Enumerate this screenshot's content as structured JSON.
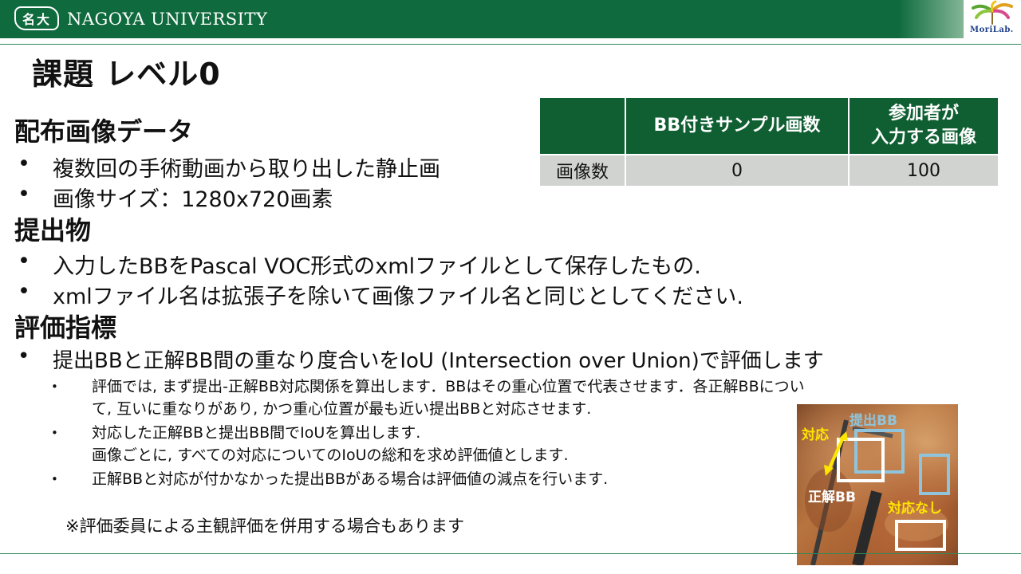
{
  "header": {
    "emblem_text": "名大",
    "university_name": "NAGOYA UNIVERSITY",
    "lab_logo_text": "MoriLab.",
    "colors": {
      "bar": "#0f6b3e"
    }
  },
  "title": "課題 レベル0",
  "sections": {
    "distribution": {
      "heading": "配布画像データ",
      "bullets": [
        "複数回の手術動画から取り出した静止画",
        "画像サイズ：1280x720画素"
      ]
    },
    "submission": {
      "heading": "提出物",
      "bullets": [
        "入力したBBをPascal VOC形式のxmlファイルとして保存したもの.",
        "xmlファイル名は拡張子を除いて画像ファイル名と同じとしてください."
      ]
    },
    "evaluation": {
      "heading": "評価指標",
      "bullet": "提出BBと正解BB間の重なり度合いをIoU (Intersection over Union)で評価します",
      "subs": [
        [
          "評価では, まず提出-正解BB対応関係を算出します．BBはその重心位置で代表させます．各正解BBについ",
          "て, 互いに重なりがあり, かつ重心位置が最も近い提出BBと対応させます."
        ],
        [
          "対応した正解BBと提出BB間でIoUを算出します.",
          "画像ごとに, すべての対応についてのIoUの総和を求め評価値とします."
        ],
        [
          "正解BBと対応が付かなかった提出BBがある場合は評価値の減点を行います."
        ]
      ]
    }
  },
  "note": "※評価委員による主観評価を併用する場合もあります",
  "table": {
    "headers": [
      "",
      "BB付きサンプル画数",
      "参加者が\n入力する画像"
    ],
    "row_label": "画像数",
    "values": [
      "0",
      "100"
    ]
  },
  "figure": {
    "label_submitted": "提出BB",
    "label_correspond": "対応",
    "label_ground_truth": "正解BB",
    "label_no_match": "対応なし",
    "colors": {
      "submitted_box": "#8fc4dc",
      "ground_truth_box": "#ffffff",
      "label_yellow": "#ffe600"
    }
  }
}
